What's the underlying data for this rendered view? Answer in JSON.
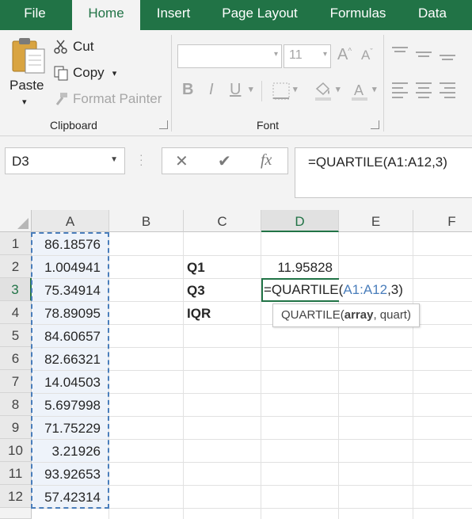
{
  "tabs": [
    "File",
    "Home",
    "Insert",
    "Page Layout",
    "Formulas",
    "Data"
  ],
  "active_tab": "Home",
  "clipboard": {
    "paste_label": "Paste",
    "cut_label": "Cut",
    "copy_label": "Copy",
    "format_painter_label": "Format Painter",
    "group_label": "Clipboard"
  },
  "font": {
    "font_name": "",
    "font_size": "11",
    "bold": "B",
    "italic": "I",
    "underline": "U",
    "group_label": "Font"
  },
  "name_box": "D3",
  "formula_bar": {
    "fx_label": "fx",
    "formula": "=QUARTILE(A1:A12,3)"
  },
  "columns": [
    "A",
    "B",
    "C",
    "D",
    "E",
    "F"
  ],
  "rows": [
    "1",
    "2",
    "3",
    "4",
    "5",
    "6",
    "7",
    "8",
    "9",
    "10",
    "11",
    "12"
  ],
  "column_a": [
    "86.18576",
    "1.004941",
    "75.34914",
    "78.89095",
    "84.60657",
    "82.66321",
    "14.04503",
    "5.697998",
    "71.75229",
    "3.21926",
    "93.92653",
    "57.42314"
  ],
  "labels": {
    "q1": "Q1",
    "q3": "Q3",
    "iqr": "IQR"
  },
  "d2_value": "11.95828",
  "edit": {
    "prefix": "=QUARTILE(",
    "ref": "A1:A12",
    "suffix": ",3)"
  },
  "tooltip": {
    "func": "QUARTILE(",
    "arg1": "array",
    "rest": ", quart)"
  },
  "colors": {
    "excel_green": "#217346",
    "ref_blue": "#4a7ebb"
  }
}
